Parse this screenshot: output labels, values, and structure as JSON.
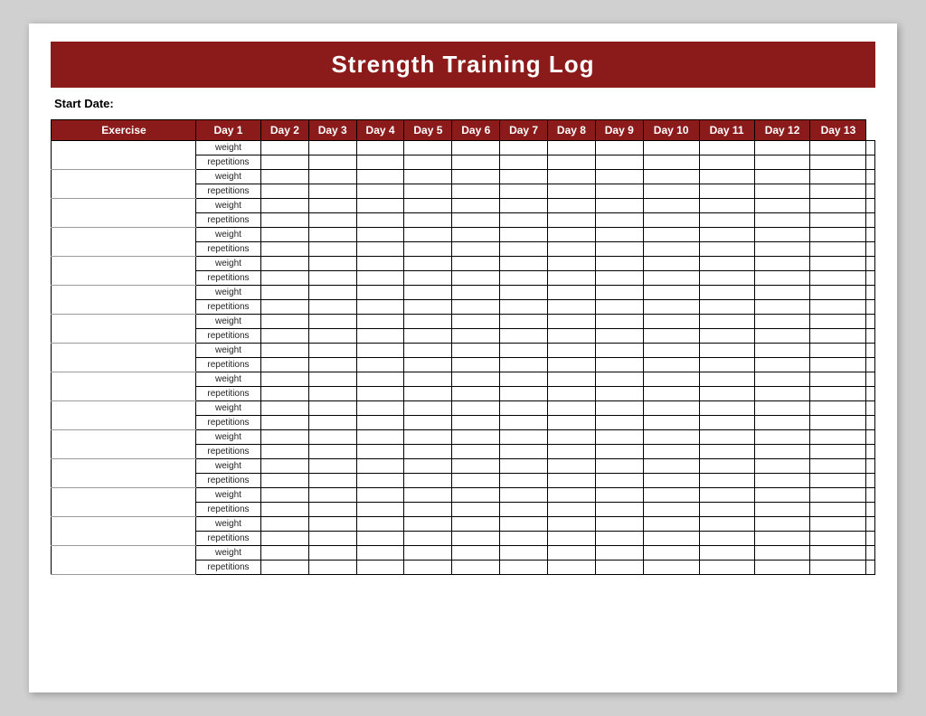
{
  "title": "Strength Training Log",
  "startDate": {
    "label": "Start Date:"
  },
  "table": {
    "headers": {
      "exercise": "Exercise",
      "days": [
        "Day 1",
        "Day 2",
        "Day 3",
        "Day 4",
        "Day 5",
        "Day 6",
        "Day 7",
        "Day 8",
        "Day 9",
        "Day 10",
        "Day 11",
        "Day 12",
        "Day 13"
      ]
    },
    "rows": [
      {
        "sub": "weight"
      },
      {
        "sub": "repetitions"
      },
      {
        "sub": "weight"
      },
      {
        "sub": "repetitions"
      },
      {
        "sub": "weight"
      },
      {
        "sub": "repetitions"
      },
      {
        "sub": "weight"
      },
      {
        "sub": "repetitions"
      },
      {
        "sub": "weight"
      },
      {
        "sub": "repetitions"
      },
      {
        "sub": "weight"
      },
      {
        "sub": "repetitions"
      },
      {
        "sub": "weight"
      },
      {
        "sub": "repetitions"
      },
      {
        "sub": "weight"
      },
      {
        "sub": "repetitions"
      },
      {
        "sub": "weight"
      },
      {
        "sub": "repetitions"
      },
      {
        "sub": "weight"
      },
      {
        "sub": "repetitions"
      },
      {
        "sub": "weight"
      },
      {
        "sub": "repetitions"
      },
      {
        "sub": "weight"
      },
      {
        "sub": "repetitions"
      },
      {
        "sub": "weight"
      },
      {
        "sub": "repetitions"
      },
      {
        "sub": "weight"
      },
      {
        "sub": "repetitions"
      },
      {
        "sub": "weight"
      },
      {
        "sub": "repetitions"
      }
    ],
    "numExercises": 15
  }
}
